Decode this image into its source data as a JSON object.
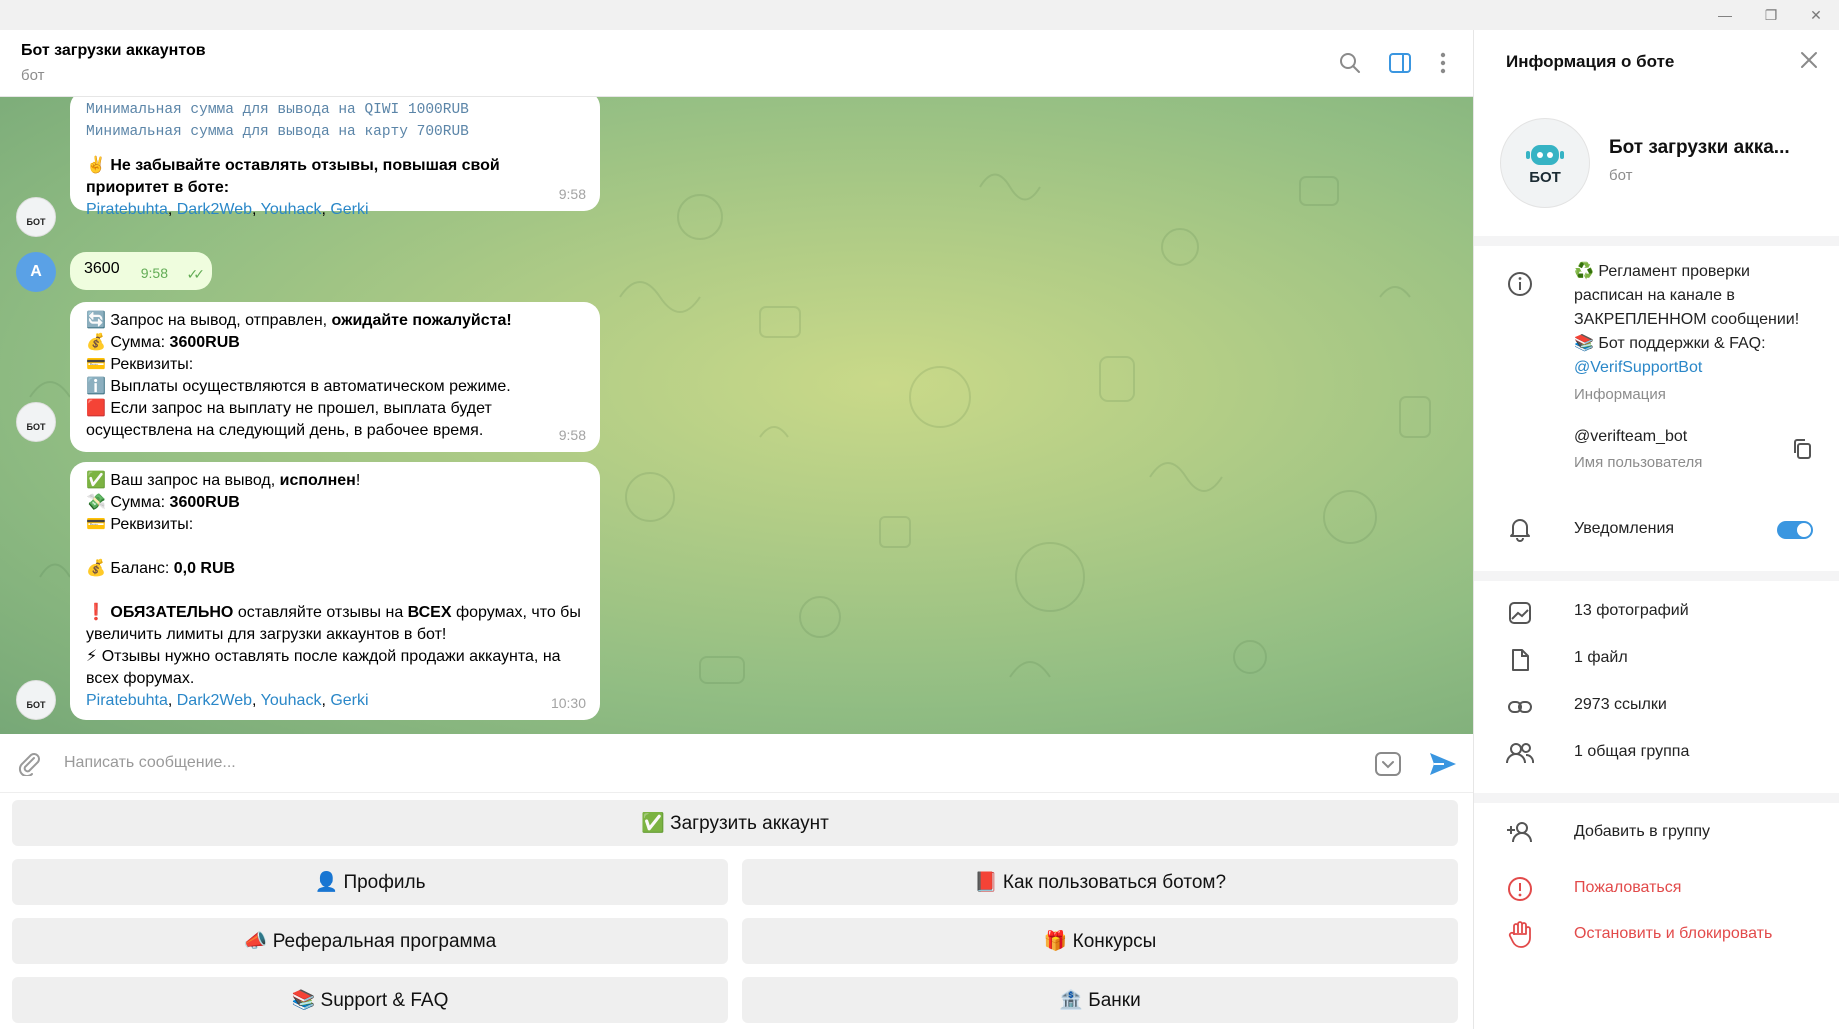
{
  "window": {
    "minimize": "—",
    "restore": "❐",
    "close": "✕"
  },
  "chat": {
    "title": "Бот загрузки аккаунтов",
    "subtitle": "бот"
  },
  "messages": {
    "m1": {
      "line1": "Минимальная сумма для вывода на QIWI 1000RUB",
      "line2": "Минимальная сумма для вывода на карту 700RUB",
      "note_emoji": "✌️",
      "note": "Не забывайте оставлять отзывы, повышая свой приоритет в боте:",
      "links": [
        "Piratebuhta",
        "Dark2Web",
        "Youhack",
        "Gerki"
      ],
      "sep": ", ",
      "time": "9:58"
    },
    "m2": {
      "avatar": "A",
      "text": "3600",
      "time": "9:58",
      "ticks": "✓✓"
    },
    "m3": {
      "l1_emoji": "🔄",
      "l1_a": "Запрос на вывод,  отправлен, ",
      "l1_b": "ожидайте пожалуйста!",
      "l2_emoji": "💰",
      "l2_a": "Сумма: ",
      "l2_b": "3600RUB",
      "l3_emoji": "💳",
      "l3_a": "Реквизиты:",
      "l4_emoji": "ℹ️",
      "l4_a": "Выплаты осуществляются в автоматическом режиме.",
      "l5_emoji": "🟥",
      "l5_a": "Если запрос на выплату не прошел, выплата будет осуществлена на следующий день, в рабочее время.",
      "time": "9:58"
    },
    "m4": {
      "l1_emoji": "✅",
      "l1_a": "Ваш запрос на вывод, ",
      "l1_b": "исполнен",
      "l1_c": "!",
      "l2_emoji": "💸",
      "l2_a": "Сумма: ",
      "l2_b": "3600RUB",
      "l3_emoji": "💳",
      "l3_a": "Реквизиты:",
      "l4_emoji": "💰",
      "l4_a": "Баланс: ",
      "l4_b": "0,0 RUB",
      "l5_emoji": "❗",
      "l5_a": "ОБЯЗАТЕЛЬНО",
      "l5_b": " оставляйте отзывы на ",
      "l5_c": "ВСЕХ",
      "l5_d": " форумах, что бы увеличить лимиты для загрузки аккаунтов в бот!",
      "l6_emoji": "⚡",
      "l6_a": "Отзывы нужно оставлять после каждой продажи аккаунта, на всех форумах.",
      "links": [
        "Piratebuhta",
        "Dark2Web",
        "Youhack",
        "Gerki"
      ],
      "sep": ", ",
      "time": "10:30"
    },
    "bot_avatar": "БОТ"
  },
  "composer": {
    "placeholder": "Написать сообщение..."
  },
  "keyboard": {
    "upload": "✅ Загрузить аккаунт",
    "profile": "👤 Профиль",
    "howto": "📕 Как пользоваться ботом?",
    "referral": "📣 Реферальная программа",
    "contests": "🎁 Конкурсы",
    "support": "📚 Support & FAQ",
    "banks": "🏦 Банки"
  },
  "panel": {
    "title": "Информация о боте",
    "bot_name": "Бот загрузки акка...",
    "bot_sub": "бот",
    "avatar_text": "БОТ",
    "info_l1": "♻️ Регламент проверки",
    "info_l2": "расписан на канале в",
    "info_l3": "ЗАКРЕПЛЕННОМ сообщении!",
    "info_l4": "📚 Бот поддержки & FAQ:",
    "info_link": "@VerifSupportBot",
    "info_caption": "Информация",
    "username": "@verifteam_bot",
    "username_caption": "Имя пользователя",
    "notifications": "Уведомления",
    "photos": "13 фотографий",
    "files": "1 файл",
    "links": "2973 ссылки",
    "groups": "1 общая группа",
    "add_group": "Добавить в группу",
    "report": "Пожаловаться",
    "block": "Остановить и блокировать"
  },
  "colors": {
    "accent": "#3a96e0",
    "danger": "#e24a4a",
    "link": "#2a87c8"
  }
}
